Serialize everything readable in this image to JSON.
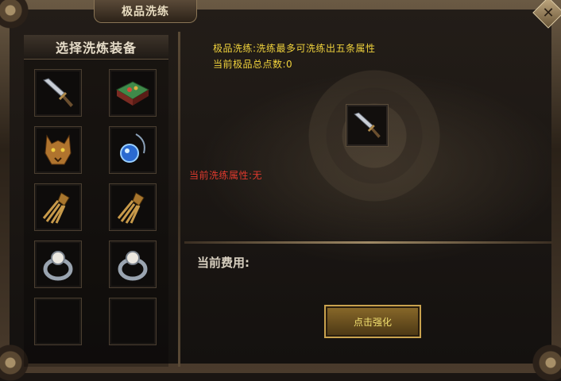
{
  "window": {
    "title": "极品洗练",
    "close_icon": "close-x-icon"
  },
  "equipment_panel": {
    "header": "选择洗炼装备",
    "slots": [
      {
        "item": "sword"
      },
      {
        "item": "tome"
      },
      {
        "item": "wolf-helmet"
      },
      {
        "item": "necklace"
      },
      {
        "item": "gauntlet"
      },
      {
        "item": "gauntlet"
      },
      {
        "item": "ring"
      },
      {
        "item": "ring"
      },
      {
        "item": "empty"
      },
      {
        "item": "empty"
      }
    ]
  },
  "info": {
    "description": "极品洗练:洗练最多可洗练出五条属性",
    "total_points": "当前极品总点数:0",
    "current_attribute": "当前洗练属性:无"
  },
  "selected_slot": {
    "item": "sword"
  },
  "cost": {
    "label": "当前费用:"
  },
  "action": {
    "enhance_label": "点击强化"
  },
  "colors": {
    "info_text": "#f0d23c",
    "attribute_text": "#e03a2e",
    "button_text": "#f2e070"
  }
}
